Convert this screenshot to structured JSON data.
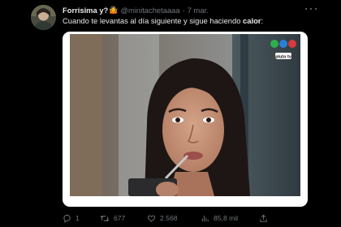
{
  "tweet": {
    "display_name": "Forrisima y?",
    "emoji": "🤷",
    "handle": "@minitachetaaaa",
    "separator": "·",
    "date": "7 mar.",
    "text_prefix": "Cuando te levantas al día siguiente y sigue haciendo ",
    "text_bold": "calor",
    "text_suffix": ":"
  },
  "media": {
    "channel_logo_text": "pluto tv"
  },
  "actions": {
    "replies": "1",
    "retweets": "677",
    "likes": "2.568",
    "views": "85,8 mil"
  },
  "colors": {
    "background": "#000000",
    "text_primary": "#e7e9ea",
    "text_secondary": "#71767b",
    "media_frame": "#ffffff"
  },
  "icons": [
    "avatar",
    "more-icon",
    "reply-icon",
    "retweet-icon",
    "like-icon",
    "views-icon",
    "share-icon"
  ]
}
